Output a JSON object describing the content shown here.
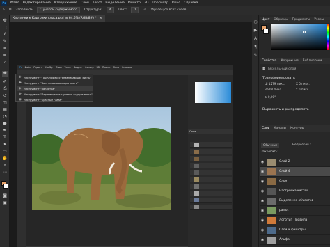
{
  "app": {
    "logo": "Ps"
  },
  "menubar": {
    "items": [
      "Файл",
      "Редактирование",
      "Изображение",
      "Слои",
      "Текст",
      "Выделение",
      "Фильтр",
      "3D",
      "Просмотр",
      "Окно",
      "Справка"
    ]
  },
  "options": {
    "zoom_label": "Заполнить",
    "sample_value": "С учетом содержимого",
    "structure_label": "Структура:",
    "structure_value": "4",
    "color_label": "Цвет:",
    "color_value": "0",
    "checkbox_label": "Образец со всех слоев"
  },
  "document_tab": {
    "title": "Картинки к Карточки курса.psd @ 64,6% (RGB/8#) *"
  },
  "flyout": {
    "items": [
      {
        "icon": "spot-healing-icon",
        "label": "Инструмент \"Точечная восстанавливающая кисть\""
      },
      {
        "icon": "healing-brush-icon",
        "label": "Инструмент \"Восстанавливающая кисть\""
      },
      {
        "icon": "patch-icon",
        "label": "Инструмент \"Заплатка\""
      },
      {
        "icon": "content-aware-move-icon",
        "label": "Инструмент \"Перемещение с учетом содержимого\""
      },
      {
        "icon": "red-eye-icon",
        "label": "Инструмент \"Красные глаза\""
      }
    ]
  },
  "color_panel": {
    "tabs": [
      "Цвет",
      "Образцы",
      "Градиенты",
      "Узоры"
    ],
    "accent": "#e8a36c"
  },
  "properties_panel": {
    "tabs": [
      "Свойства",
      "Коррекция",
      "Библиотеки"
    ],
    "layer_type": "Пиксельный слой",
    "section": "Трансформировать",
    "w": "1279 пикс.",
    "h": "900 пикс.",
    "x": "0 пикс.",
    "y": "0 пикс.",
    "angle": "0,00°",
    "align_section": "Выровнять и распределить"
  },
  "layers_panel": {
    "tabs": [
      "Слои",
      "Каналы",
      "Контуры"
    ],
    "filter_label": "Обычные",
    "opacity_label": "Непрозрач.:",
    "lock_label": "Закрепить:",
    "layers": [
      {
        "name": "Слой 2",
        "thumb": "#9a8c70"
      },
      {
        "name": "Слой 4",
        "thumb": "#9b7450"
      },
      {
        "name": "Слон",
        "thumb": "#8a6a44"
      },
      {
        "name": "Настройка кистей",
        "thumb": "#555555"
      },
      {
        "name": "Выделение объектов",
        "thumb": "#6b6b6b"
      },
      {
        "name": "parrot",
        "thumb": "#7a9a60"
      },
      {
        "name": "Логотип Правила",
        "thumb": "#cf7a3a"
      },
      {
        "name": "Слои и фильтры",
        "thumb": "#4d6a8a"
      },
      {
        "name": "Альфа",
        "thumb": "#a0a0a0"
      }
    ]
  },
  "inner_window": {
    "menu": [
      "Файл",
      "Редакт.",
      "Изобр.",
      "Слои",
      "Текст",
      "Выдел.",
      "Фильтр",
      "3D",
      "Просм.",
      "Окно",
      "Справка"
    ],
    "panel_header": "Слои"
  }
}
